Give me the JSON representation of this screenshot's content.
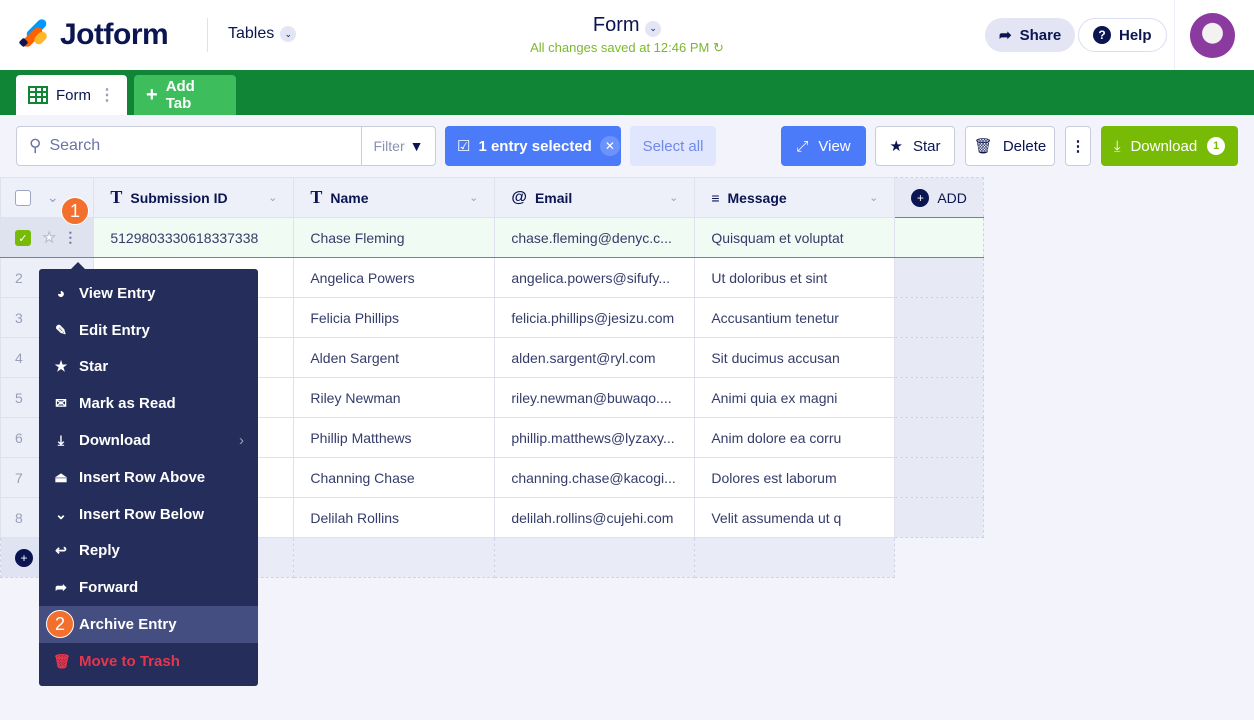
{
  "header": {
    "logo": "Jotform",
    "tables_label": "Tables",
    "form_title": "Form",
    "saved_status": "All changes saved at 12:46 PM",
    "share_label": "Share",
    "help_label": "Help"
  },
  "tabs": [
    {
      "label": "Form"
    },
    {
      "label": "Add Tab"
    }
  ],
  "toolbar": {
    "search_placeholder": "Search",
    "filter_label": "Filter",
    "selection_label": "1 entry selected",
    "select_all_label": "Select all",
    "view_label": "View",
    "star_label": "Star",
    "delete_label": "Delete",
    "download_label": "Download",
    "download_count": "1"
  },
  "columns": [
    {
      "label": "Submission ID",
      "icon": "T"
    },
    {
      "label": "Name",
      "icon": "T"
    },
    {
      "label": "Email",
      "icon": "@"
    },
    {
      "label": "Message",
      "icon": "≡"
    }
  ],
  "add_column_label": "ADD",
  "rows": [
    {
      "num": "1",
      "id": "5129803330618337338",
      "name": "Chase Fleming",
      "email": "chase.fleming@denyc.c...",
      "message": "Quisquam et voluptat"
    },
    {
      "num": "2",
      "id": "",
      "name": "Angelica Powers",
      "email": "angelica.powers@sifufy...",
      "message": "Ut doloribus et sint"
    },
    {
      "num": "3",
      "id": "",
      "name": "Felicia Phillips",
      "email": "felicia.phillips@jesizu.com",
      "message": "Accusantium tenetur"
    },
    {
      "num": "4",
      "id": "",
      "name": "Alden Sargent",
      "email": "alden.sargent@ryl.com",
      "message": "Sit ducimus accusan"
    },
    {
      "num": "5",
      "id": "",
      "name": "Riley Newman",
      "email": "riley.newman@buwaqo....",
      "message": "Animi quia ex magni"
    },
    {
      "num": "6",
      "id": "",
      "name": "Phillip Matthews",
      "email": "phillip.matthews@lyzaxy...",
      "message": "Anim dolore ea corru"
    },
    {
      "num": "7",
      "id": "",
      "name": "Channing Chase",
      "email": "channing.chase@kacogi...",
      "message": "Dolores est laborum"
    },
    {
      "num": "8",
      "id": "",
      "name": "Delilah Rollins",
      "email": "delilah.rollins@cujehi.com",
      "message": "Velit assumenda ut q"
    }
  ],
  "context_menu": [
    {
      "label": "View Entry",
      "icon": "view-icon"
    },
    {
      "label": "Edit Entry",
      "icon": "edit-icon"
    },
    {
      "label": "Star",
      "icon": "star-icon"
    },
    {
      "label": "Mark as Read",
      "icon": "envelope-icon"
    },
    {
      "label": "Download",
      "icon": "download-icon"
    },
    {
      "label": "Insert Row Above",
      "icon": "insert-above-icon"
    },
    {
      "label": "Insert Row Below",
      "icon": "insert-below-icon"
    },
    {
      "label": "Reply",
      "icon": "reply-icon"
    },
    {
      "label": "Forward",
      "icon": "forward-icon"
    },
    {
      "label": "Archive Entry",
      "icon": "archive-icon"
    },
    {
      "label": "Move to Trash",
      "icon": "trash-icon"
    }
  ],
  "markers": [
    "1",
    "2"
  ],
  "colors": {
    "green_band": "#0f8535",
    "accent_blue": "#4c7bfa",
    "download_green": "#78bb07",
    "menu_bg": "#252d5b",
    "marker": "#f36f2e",
    "danger": "#e7364b"
  }
}
